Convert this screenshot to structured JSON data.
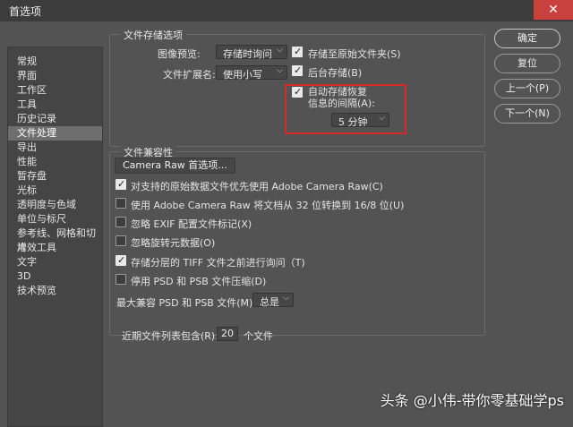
{
  "window": {
    "title": "首选项",
    "close_glyph": "✕"
  },
  "sidebar": {
    "items": [
      {
        "label": "常规"
      },
      {
        "label": "界面"
      },
      {
        "label": "工作区"
      },
      {
        "label": "工具"
      },
      {
        "label": "历史记录"
      },
      {
        "label": "文件处理"
      },
      {
        "label": "导出"
      },
      {
        "label": "性能"
      },
      {
        "label": "暂存盘"
      },
      {
        "label": "光标"
      },
      {
        "label": "透明度与色域"
      },
      {
        "label": "单位与标尺"
      },
      {
        "label": "参考线、网格和切片"
      },
      {
        "label": "增效工具"
      },
      {
        "label": "文字"
      },
      {
        "label": "3D"
      },
      {
        "label": "技术预览"
      }
    ],
    "selected": "文件处理"
  },
  "file_save": {
    "group_title": "文件存储选项",
    "image_preview_label": "图像预览:",
    "image_preview_value": "存储时询问",
    "ext_label": "文件扩展名:",
    "ext_value": "使用小写",
    "save_original_folder": {
      "label": "存储至原始文件夹(S)",
      "checked": true
    },
    "background_save": {
      "label": "后台存储(B)",
      "checked": true
    },
    "autosave": {
      "label_line1": "自动存储恢复",
      "label_line2": "信息的间隔(A):",
      "checked": true
    },
    "autosave_interval": "5 分钟"
  },
  "compat": {
    "group_title": "文件兼容性",
    "camera_raw_button": "Camera Raw 首选项...",
    "options": [
      {
        "label": "对支持的原始数据文件优先使用 Adobe Camera Raw(C)",
        "checked": true
      },
      {
        "label": "使用 Adobe Camera Raw 将文档从 32 位转换到 16/8 位(U)",
        "checked": false
      },
      {
        "label": "忽略 EXIF 配置文件标记(X)",
        "checked": false
      },
      {
        "label": "忽略旋转元数据(O)",
        "checked": false
      },
      {
        "label": "存储分层的 TIFF 文件之前进行询问（T)",
        "checked": true
      },
      {
        "label": "停用 PSD 和 PSB 文件压缩(D)",
        "checked": false
      }
    ],
    "max_compat_label": "最大兼容 PSD 和 PSB 文件(M):",
    "max_compat_value": "总是"
  },
  "recent": {
    "prefix": "近期文件列表包含(R):",
    "value": "20",
    "suffix": "个文件"
  },
  "buttons": {
    "ok": "确定",
    "reset": "复位",
    "prev": "上一个(P)",
    "next": "下一个(N)"
  },
  "watermark": "头条 @小伟-带你零基础学ps"
}
